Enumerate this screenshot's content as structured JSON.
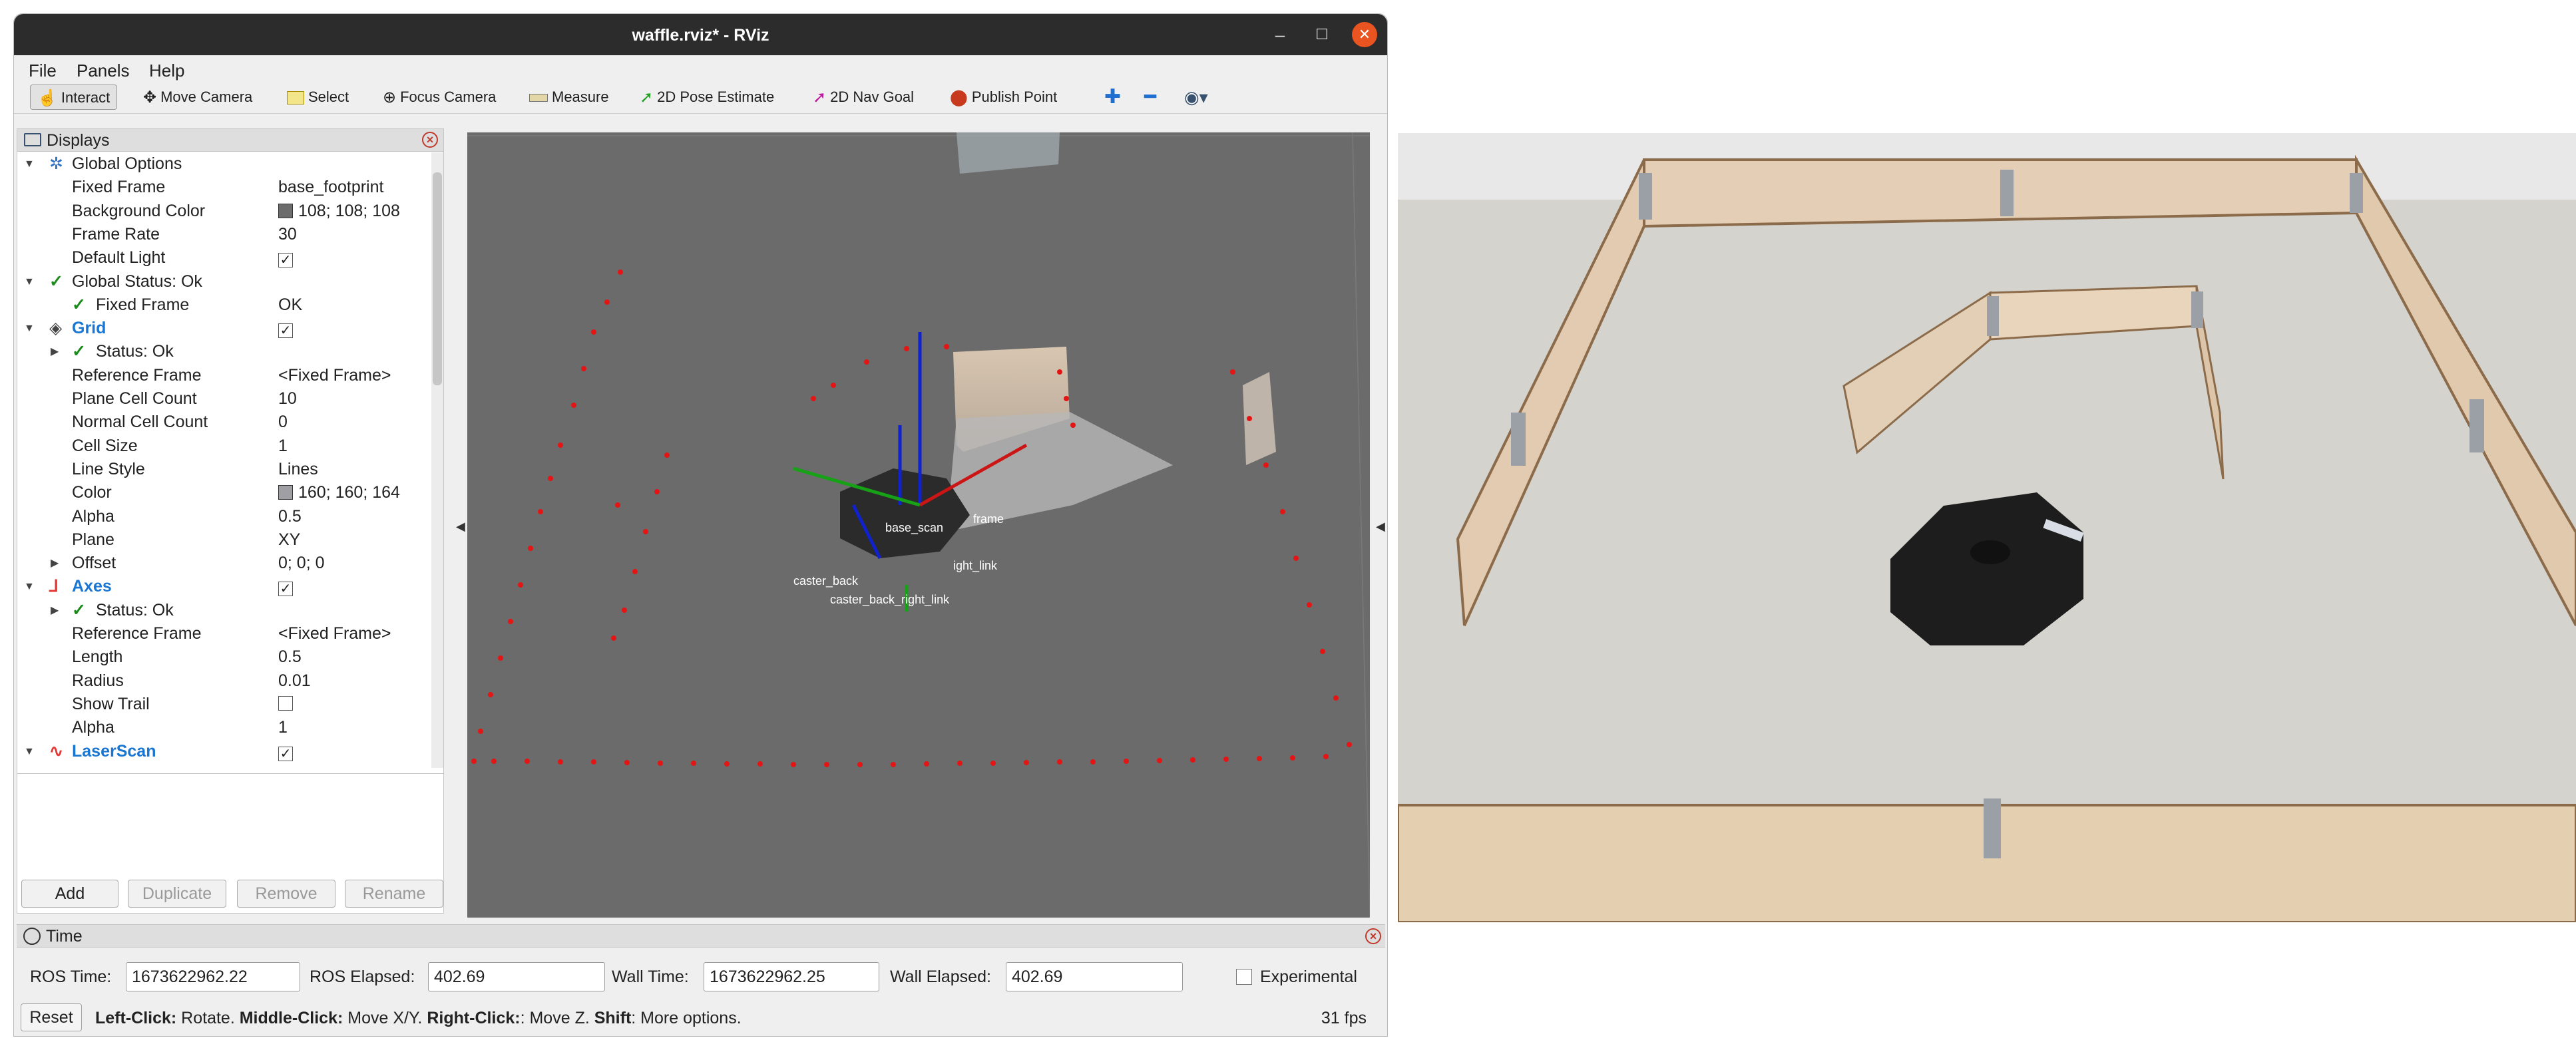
{
  "window": {
    "title": "waffle.rviz* - RViz",
    "min_icon": "minimize-icon",
    "max_icon": "maximize-icon",
    "close_icon": "close-icon"
  },
  "menu": {
    "file": "File",
    "panels": "Panels",
    "help": "Help"
  },
  "toolbar": {
    "interact": "Interact",
    "move_camera": "Move Camera",
    "select": "Select",
    "focus_camera": "Focus Camera",
    "measure": "Measure",
    "pose_estimate": "2D Pose Estimate",
    "nav_goal": "2D Nav Goal",
    "publish_point": "Publish Point"
  },
  "displays": {
    "title": "Displays",
    "rows": [
      {
        "key": "Global Options",
        "value": ""
      },
      {
        "key": "Fixed Frame",
        "value": "base_footprint"
      },
      {
        "key": "Background Color",
        "value": "108; 108; 108",
        "swatch": "#6c6c6c"
      },
      {
        "key": "Frame Rate",
        "value": "30"
      },
      {
        "key": "Default Light",
        "value": "✓"
      },
      {
        "key": "Global Status: Ok",
        "value": ""
      },
      {
        "key": "Fixed Frame",
        "value": "OK"
      },
      {
        "key": "Grid",
        "value": "✓"
      },
      {
        "key": "Status: Ok",
        "value": ""
      },
      {
        "key": "Reference Frame",
        "value": "<Fixed Frame>"
      },
      {
        "key": "Plane Cell Count",
        "value": "10"
      },
      {
        "key": "Normal Cell Count",
        "value": "0"
      },
      {
        "key": "Cell Size",
        "value": "1"
      },
      {
        "key": "Line Style",
        "value": "Lines"
      },
      {
        "key": "Color",
        "value": "160; 160; 164",
        "swatch": "#a0a0a4"
      },
      {
        "key": "Alpha",
        "value": "0.5"
      },
      {
        "key": "Plane",
        "value": "XY"
      },
      {
        "key": "Offset",
        "value": "0; 0; 0"
      },
      {
        "key": "Axes",
        "value": "✓"
      },
      {
        "key": "Status: Ok",
        "value": ""
      },
      {
        "key": "Reference Frame",
        "value": "<Fixed Frame>"
      },
      {
        "key": "Length",
        "value": "0.5"
      },
      {
        "key": "Radius",
        "value": "0.01"
      },
      {
        "key": "Show Trail",
        "value": ""
      },
      {
        "key": "Alpha",
        "value": "1"
      },
      {
        "key": "LaserScan",
        "value": "✓"
      }
    ],
    "buttons": {
      "add": "Add",
      "duplicate": "Duplicate",
      "remove": "Remove",
      "rename": "Rename"
    }
  },
  "view3d": {
    "frame_labels": [
      "base_scan",
      "caster_back",
      "caster_back_right_link",
      "ight_link",
      "frame"
    ]
  },
  "time": {
    "title": "Time",
    "ros_time_label": "ROS Time:",
    "ros_time": "1673622962.22",
    "ros_elapsed_label": "ROS Elapsed:",
    "ros_elapsed": "402.69",
    "wall_time_label": "Wall Time:",
    "wall_time": "1673622962.25",
    "wall_elapsed_label": "Wall Elapsed:",
    "wall_elapsed": "402.69",
    "experimental": "Experimental",
    "reset": "Reset",
    "help": {
      "left_click": "Left-Click:",
      "left_action": " Rotate. ",
      "middle_click": "Middle-Click:",
      "middle_action": " Move X/Y. ",
      "right_click": "Right-Click:",
      "right_action": ": Move Z. ",
      "shift": "Shift",
      "shift_action": ": More options."
    },
    "fps": "31 fps"
  }
}
